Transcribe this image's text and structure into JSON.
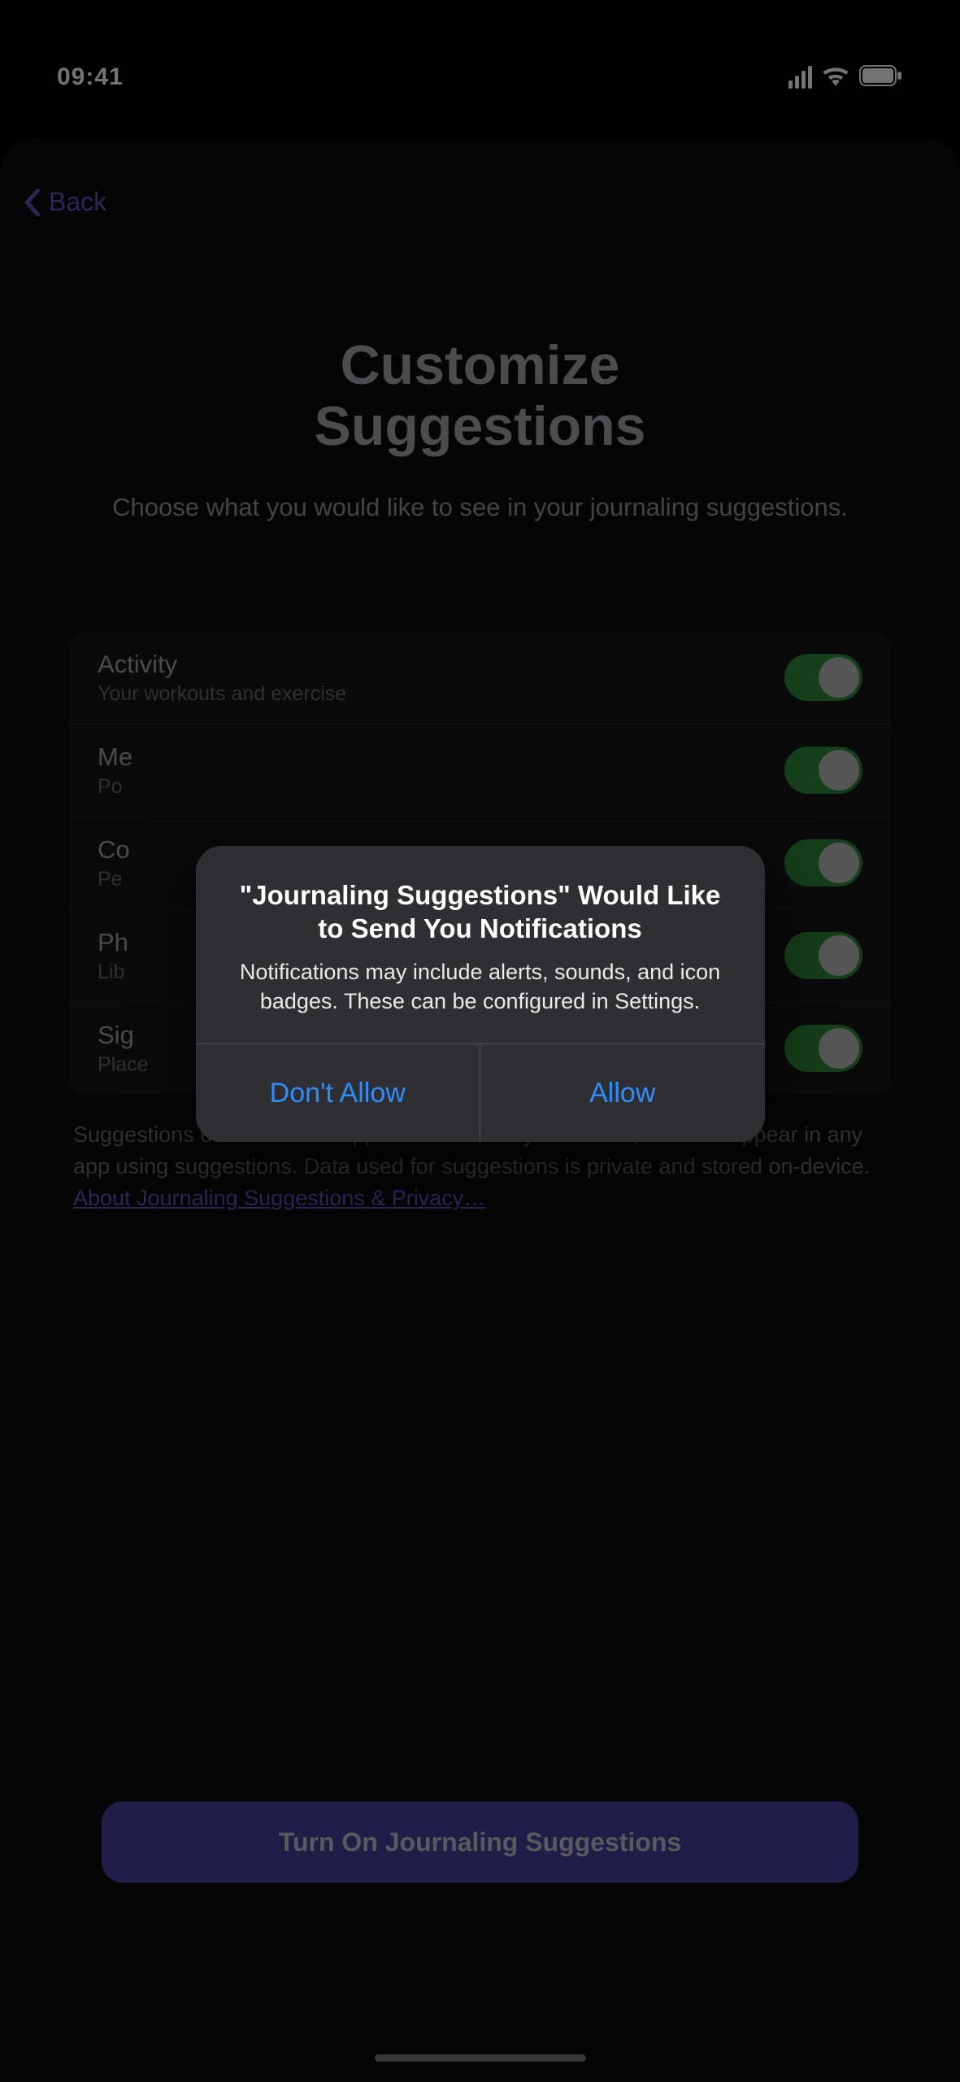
{
  "statusBar": {
    "time": "09:41"
  },
  "nav": {
    "backLabel": "Back"
  },
  "header": {
    "titleLine1": "Customize",
    "titleLine2": "Suggestions",
    "subtitle": "Choose what you would like to see in your journaling suggestions."
  },
  "options": [
    {
      "label": "Activity",
      "sub": "Your workouts and exercise",
      "on": true
    },
    {
      "label": "Me",
      "sub": "Po",
      "on": true
    },
    {
      "label": "Co",
      "sub": "Pe",
      "on": true
    },
    {
      "label": "Ph",
      "sub": "Lib",
      "on": true
    },
    {
      "label": "Sig",
      "sub": "Place",
      "on": true
    }
  ],
  "footer": {
    "text": "Suggestions use data from apps and services you turn on, and can appear in any app using suggestions. Data used for suggestions is private and stored on-device. ",
    "linkText": "About Journaling Suggestions & Privacy…"
  },
  "primaryButton": {
    "label": "Turn On Journaling Suggestions"
  },
  "alert": {
    "title": "\"Journaling Suggestions\" Would Like to Send You Notifications",
    "message": "Notifications may include alerts, sounds, and icon badges. These can be configured in Settings.",
    "dontAllow": "Don't Allow",
    "allow": "Allow"
  }
}
